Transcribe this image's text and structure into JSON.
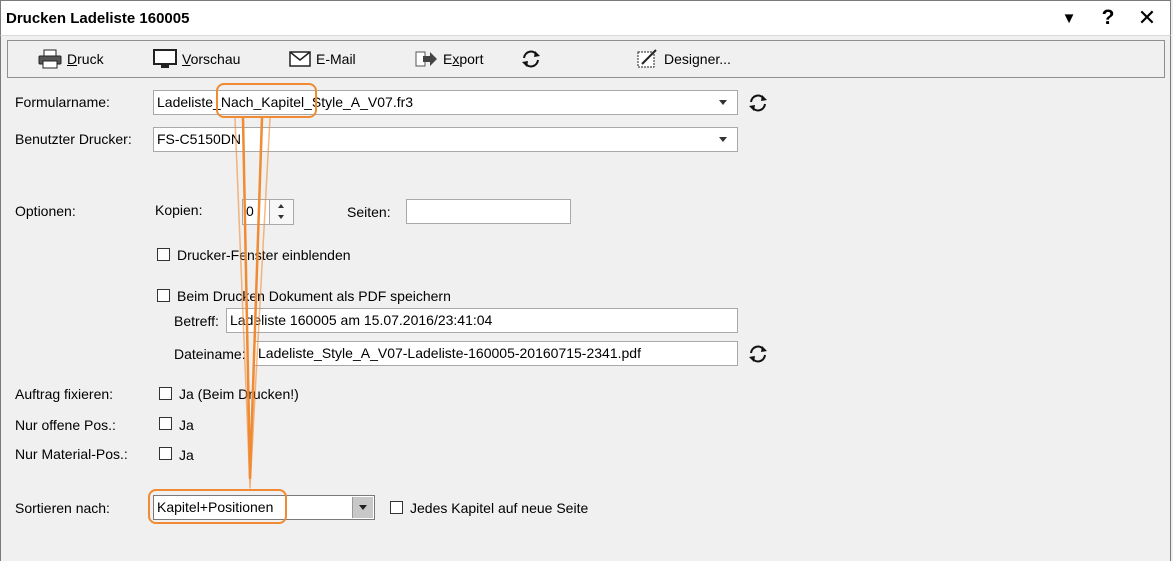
{
  "window": {
    "title": "Drucken  Ladeliste  160005",
    "controls": {
      "menu_glyph": "▼",
      "help_glyph": "?",
      "close_glyph": "✕"
    }
  },
  "toolbar": {
    "druck": {
      "accel": "D",
      "rest": "ruck"
    },
    "vorschau": {
      "accel": "V",
      "rest": "orschau"
    },
    "email": {
      "label": "E-Mail"
    },
    "export": {
      "pre": "E",
      "accel": "x",
      "rest": "port"
    },
    "designer": {
      "label": "Designer..."
    }
  },
  "form": {
    "formularname_label": "Formularname:",
    "formularname_value": "Ladeliste_Nach_Kapitel_Style_A_V07.fr3",
    "drucker_label": "Benutzter Drucker:",
    "drucker_value": "FS-C5150DN",
    "optionen_label": "Optionen:",
    "kopien_label": "Kopien:",
    "kopien_value": "0",
    "seiten_label": "Seiten:",
    "seiten_value": "",
    "drucker_fenster_label": "Drucker-Fenster einblenden",
    "pdf_label": "Beim Drucken Dokument als PDF speichern",
    "betreff_label": "Betreff:",
    "betreff_value": "Ladeliste 160005 am 15.07.2016/23:41:04",
    "dateiname_label": "Dateiname:",
    "dateiname_value": "Ladeliste_Style_A_V07-Ladeliste-160005-20160715-2341.pdf",
    "auftrag_label": "Auftrag fixieren:",
    "auftrag_cb_label": "Ja (Beim Drucken!)",
    "offene_label": "Nur offene Pos.:",
    "offene_cb_label": "Ja",
    "material_label": "Nur Material-Pos.:",
    "material_cb_label": "Ja",
    "sortieren_label": "Sortieren nach:",
    "sortieren_value": "Kapitel+Positionen",
    "kapitel_seite_label": "Jedes Kapitel auf neue Seite"
  },
  "colors": {
    "annotation": "#f08a33",
    "frame": "#7a7a7a"
  }
}
